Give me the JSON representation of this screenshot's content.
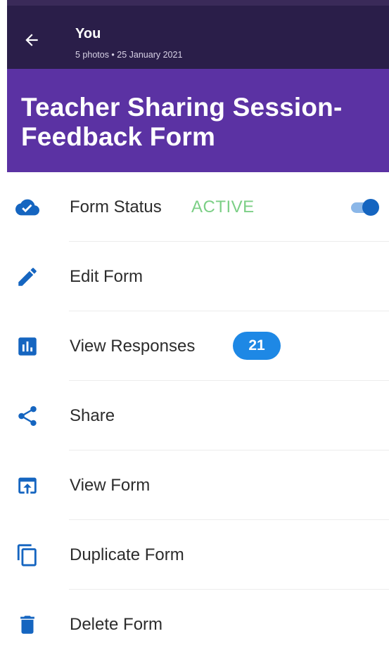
{
  "header": {
    "title": "You",
    "subtitle": "5 photos  •  25 January 2021"
  },
  "form": {
    "title": "Teacher Sharing Session-Feedback Form"
  },
  "menu": {
    "items": [
      {
        "label": "Form Status",
        "icon": "cloud-check-icon",
        "status": "ACTIVE",
        "toggle_on": true
      },
      {
        "label": "Edit Form",
        "icon": "pencil-icon"
      },
      {
        "label": "View Responses",
        "icon": "bar-chart-icon",
        "badge": "21"
      },
      {
        "label": "Share",
        "icon": "share-icon"
      },
      {
        "label": "View Form",
        "icon": "open-in-new-icon"
      },
      {
        "label": "Duplicate Form",
        "icon": "copy-icon"
      },
      {
        "label": "Delete Form",
        "icon": "trash-icon"
      }
    ]
  },
  "colors": {
    "header_bg": "#2a1e49",
    "banner_bg": "#5b32a3",
    "icon_blue": "#1565c0",
    "status_green": "#7ccf86",
    "badge_blue": "#1e88e5"
  }
}
